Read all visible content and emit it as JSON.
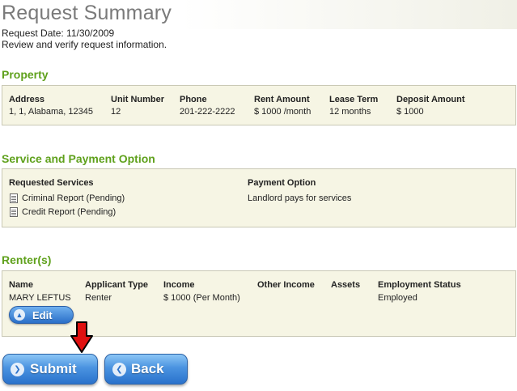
{
  "header": {
    "title": "Request Summary",
    "request_date": "Request Date: 11/30/2009",
    "subtitle": "Review and verify request information."
  },
  "property": {
    "section_title": "Property",
    "columns": [
      "Address",
      "Unit Number",
      "Phone",
      "Rent Amount",
      "Lease Term",
      "Deposit Amount"
    ],
    "values": [
      "1, 1, Alabama, 12345",
      "12",
      "201-222-2222",
      "$ 1000 /month",
      "12 months",
      "$ 1000"
    ]
  },
  "service": {
    "section_title": "Service and Payment Option",
    "requested_label": "Requested Services",
    "services": [
      "Criminal Report (Pending)",
      "Credit Report (Pending)"
    ],
    "payment_label": "Payment Option",
    "payment_value": "Landlord pays for services"
  },
  "renters": {
    "section_title": "Renter(s)",
    "columns": [
      "Name",
      "Applicant Type",
      "Income",
      "Other Income",
      "Assets",
      "Employment Status"
    ],
    "values": [
      "MARY LEFTUS",
      "Renter",
      "$ 1000 (Per Month)",
      "",
      "",
      "Employed"
    ],
    "edit_label": "Edit"
  },
  "actions": {
    "submit_label": "Submit",
    "back_label": "Back"
  },
  "colors": {
    "section_title": "#5fa11c",
    "panel_bg": "#f6f5e4",
    "button_blue": "#2a72cc",
    "arrow_red": "#e01010"
  },
  "icons": {
    "service_item": "document-icon",
    "edit": "chevron-up-icon",
    "submit": "chevron-right-icon",
    "back": "chevron-left-icon",
    "pointer": "down-arrow-icon"
  }
}
